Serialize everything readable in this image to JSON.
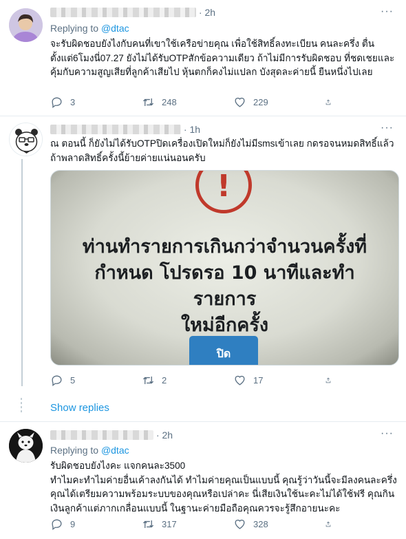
{
  "tweets": [
    {
      "time": "2h",
      "reply_prefix": "Replying to",
      "reply_handle": "@dtac",
      "text": "จะรับผิดชอบยังไงกับคนที่เขาใช้เครือข่ายคุณ เพื่อใช้สิทธิ์ลงทะเบียน คนละครึ่ง ตื่นตั้งแต่6โมงนี่07.27 ยังไม่ได้รับOTPสักข้อความเดียว ถ้าไม่มีการรับผิดชอบ ที่ชดเชยและคุ้มกับความสูญเสียที่ลูกค้าเสียไป หุ้นตกก็คงไม่แปลก บังสุดละค่ายนี้ ยืนหนึ่งไปเลย",
      "replies": "3",
      "retweets": "248",
      "likes": "229"
    },
    {
      "time": "1h",
      "text": "ณ ตอนนี้ ก็ยังไม่ได้รับOTPปิดเครื่องเปิดใหม่ก็ยังไม่มีsmsเข้าเลย กดรอจนหมดสิทธิ์แล้ว ถ้าพลาดสิทธิ์ครั้งนี้ย้ายค่ายแน่นอนครับ",
      "media_message": "ท่านทำรายการเกินกว่าจำนวนครั้งที่\nกำหนด โปรดรอ 10 นาทีและทำรายการ\nใหม่อีกครั้ง",
      "media_button": "ปิด",
      "replies": "5",
      "retweets": "2",
      "likes": "17"
    },
    {
      "time": "2h",
      "reply_prefix": "Replying to",
      "reply_handle": "@dtac",
      "text": "รับผิดชอบยังไงคะ แจกคนละ3500\nทำไมคะทำไมค่ายอื่นเค้าลงกันได้ ทำไมค่ายคุณเป็นแบบนี้ คุณรู้ว่าวันนี้จะมีลงคนละครึ่ง คุณได้เตรียมความพร้อมระบบของคุณหรือเปล่าคะ นี่เสียเงินใช้นะคะไม่ได้ใช้ฟรี คุณกินเงินลูกค้าแต่ภากเกลื่อนแบบนี้ ในฐานะค่ายมือถือคุณควรจะรู้สึกอายนะคะ",
      "replies": "9",
      "retweets": "317",
      "likes": "328"
    }
  ],
  "show_replies": "Show replies",
  "more_glyph": "···",
  "separator": "·",
  "icons": [
    "reply-icon",
    "retweet-icon",
    "like-icon",
    "share-icon",
    "more-icon"
  ],
  "colors": {
    "link": "#1b95e0",
    "muted": "#5b7083",
    "alert": "#c0392b",
    "button": "#2f7fc1"
  }
}
